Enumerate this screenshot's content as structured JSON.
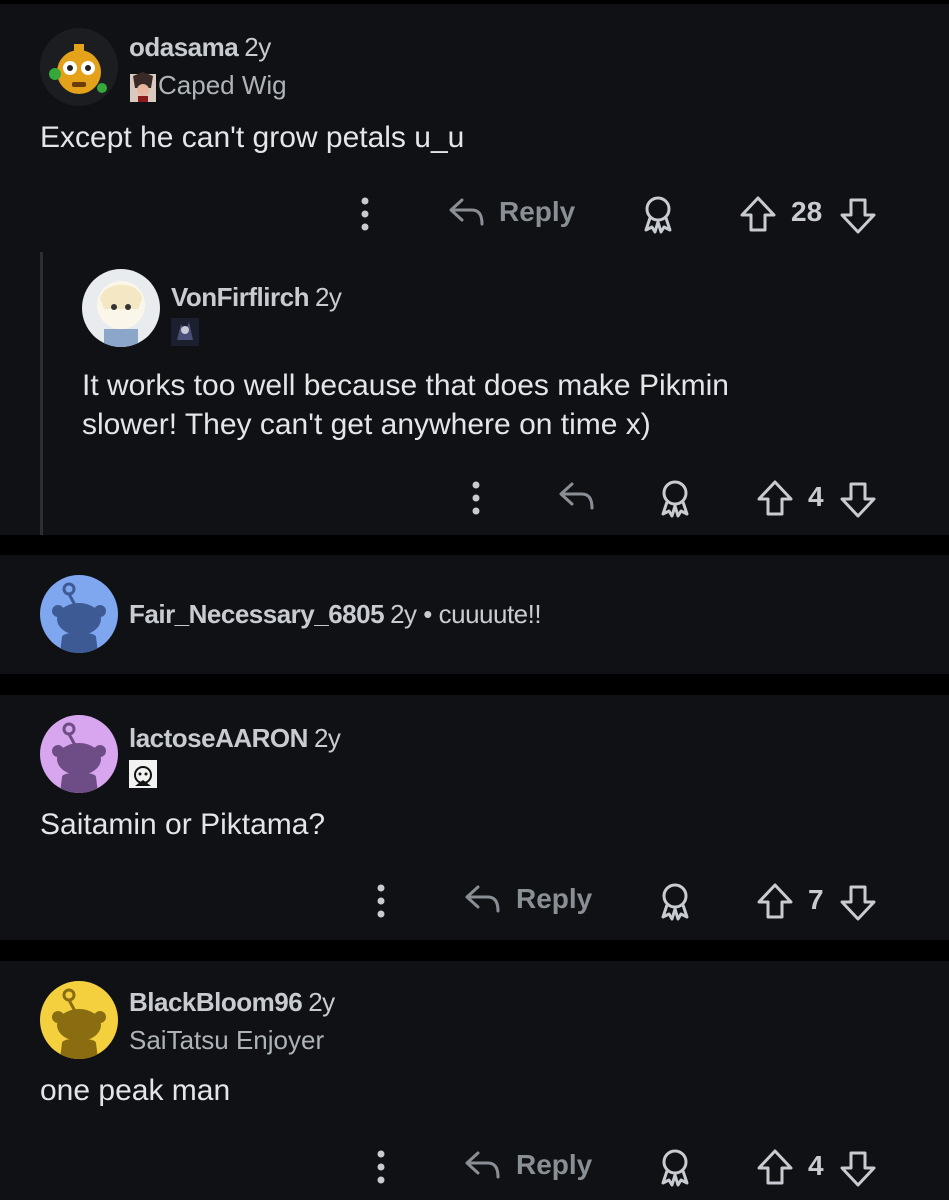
{
  "comments": [
    {
      "username": "odasama",
      "age": "2y",
      "flair": "Caped Wig",
      "body": "Except he can't grow petals u_u",
      "reply_label": "Reply",
      "score": "28"
    },
    {
      "username": "VonFirflirch",
      "age": "2y",
      "body_lines": [
        "It works too well because that does make Pikmin",
        "slower! They can't get anywhere on time x)"
      ],
      "score": "4"
    },
    {
      "username": "Fair_Necessary_6805",
      "age": "2y",
      "separator": "•",
      "inline_body": "cuuuute!!"
    },
    {
      "username": "lactoseAARON",
      "age": "2y",
      "body": "Saitamin or Piktama?",
      "reply_label": "Reply",
      "score": "7"
    },
    {
      "username": "BlackBloom96",
      "age": "2y",
      "flair": "SaiTatsu Enjoyer",
      "body": "one peak man",
      "reply_label": "Reply",
      "score": "4"
    }
  ],
  "icons": {
    "more": "more-options-icon",
    "reply": "reply-arrow-icon",
    "award": "award-icon",
    "upvote": "upvote-icon",
    "downvote": "downvote-icon"
  },
  "colors": {
    "background": "#000000",
    "card": "#0f1114",
    "text": "#d7dadc",
    "muted": "#8a8f95",
    "avatar_blue": "#7ea7f0",
    "avatar_purple": "#d8a6ef",
    "avatar_yellow": "#f4d03f"
  }
}
